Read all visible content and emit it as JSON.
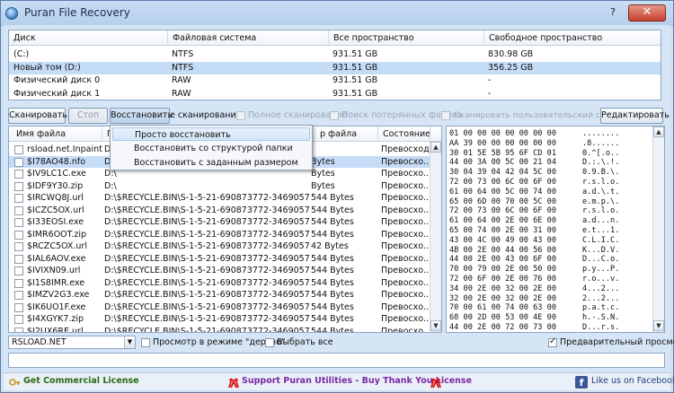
{
  "window": {
    "title": "Puran File Recovery",
    "help": "?",
    "close": "✕"
  },
  "drives": {
    "headers": [
      "Диск",
      "Файловая система",
      "Все пространство",
      "Свободное пространство"
    ],
    "rows": [
      {
        "name": "(C:)",
        "fs": "NTFS",
        "total": "931.51 GB",
        "free": "830.98 GB",
        "selected": false
      },
      {
        "name": "Новый том (D:)",
        "fs": "NTFS",
        "total": "931.51 GB",
        "free": "356.25 GB",
        "selected": true
      },
      {
        "name": "Физический диск 0",
        "fs": "RAW",
        "total": "931.51 GB",
        "free": "-",
        "selected": false
      },
      {
        "name": "Физический диск 1",
        "fs": "RAW",
        "total": "931.51 GB",
        "free": "-",
        "selected": false
      }
    ]
  },
  "toolbar": {
    "scan": "Сканировать",
    "stop": "Стоп",
    "restore": "Восстановить",
    "deep_scan": "е сканирование",
    "full_scan": "Полное сканирование",
    "lost_files": "Поиск потерянных файлов",
    "custom_list": "Сканировать пользовательский список",
    "edit": "Редактировать"
  },
  "files": {
    "headers": {
      "name": "Имя файла",
      "path": "П",
      "size": "р файла",
      "state": "Состояние"
    },
    "rows": [
      {
        "name": "rsload.net.Inpaint...",
        "path": "D:\\",
        "size": "",
        "state": "Превосходно"
      },
      {
        "name": "$I78AO48.nfo",
        "path": "D:\\",
        "size": "Bytes",
        "state": "Превосхо..."
      },
      {
        "name": "$IV9LC1C.exe",
        "path": "D:\\",
        "size": "Bytes",
        "state": "Превосхо..."
      },
      {
        "name": "$IDF9Y30.zip",
        "path": "D:\\",
        "size": "Bytes",
        "state": "Превосхо..."
      },
      {
        "name": "$IRCWQ8J.url",
        "path": "D:\\$RECYCLE.BIN\\S-1-5-21-690873772-346905789...",
        "size": "544 Bytes",
        "state": "Превосхо..."
      },
      {
        "name": "$ICZC5OX.url",
        "path": "D:\\$RECYCLE.BIN\\S-1-5-21-690873772-346905789...",
        "size": "544 Bytes",
        "state": "Превосхо..."
      },
      {
        "name": "$I33EOSI.exe",
        "path": "D:\\$RECYCLE.BIN\\S-1-5-21-690873772-346905789...",
        "size": "544 Bytes",
        "state": "Превосхо..."
      },
      {
        "name": "$IMR6OOT.zip",
        "path": "D:\\$RECYCLE.BIN\\S-1-5-21-690873772-346905789...",
        "size": "544 Bytes",
        "state": "Превосхо..."
      },
      {
        "name": "$RCZC5OX.url",
        "path": "D:\\$RECYCLE.BIN\\S-1-5-21-690873772-346905789...",
        "size": "42 Bytes",
        "state": "Превосхо..."
      },
      {
        "name": "$IAL6AOV.exe",
        "path": "D:\\$RECYCLE.BIN\\S-1-5-21-690873772-346905789...",
        "size": "544 Bytes",
        "state": "Превосхо..."
      },
      {
        "name": "$IVIXN09.url",
        "path": "D:\\$RECYCLE.BIN\\S-1-5-21-690873772-346905789...",
        "size": "544 Bytes",
        "state": "Превосхо..."
      },
      {
        "name": "$I1S8IMR.exe",
        "path": "D:\\$RECYCLE.BIN\\S-1-5-21-690873772-346905789...",
        "size": "544 Bytes",
        "state": "Превосхо..."
      },
      {
        "name": "$IMZV2G3.exe",
        "path": "D:\\$RECYCLE.BIN\\S-1-5-21-690873772-346905789...",
        "size": "544 Bytes",
        "state": "Превосхо..."
      },
      {
        "name": "$IK6UO1F.exe",
        "path": "D:\\$RECYCLE.BIN\\S-1-5-21-690873772-346905789...",
        "size": "544 Bytes",
        "state": "Превосхо..."
      },
      {
        "name": "$I4XGYK7.zip",
        "path": "D:\\$RECYCLE.BIN\\S-1-5-21-690873772-346905789...",
        "size": "544 Bytes",
        "state": "Превосхо..."
      },
      {
        "name": "$I2UX6RE.url",
        "path": "D:\\$RECYCLE.BIN\\S-1-5-21-690873772-346905789...",
        "size": "544 Bytes",
        "state": "Превосхо..."
      }
    ]
  },
  "hex": {
    "rows": [
      {
        "h": "01 00 00 00 00 00 00 00",
        "a": "........"
      },
      {
        "h": "AA 39 00 00 00 00 00 00",
        "a": ".8......"
      },
      {
        "h": "30 01 5E 5B 95 6F CD 01",
        "a": "0.^[.o.."
      },
      {
        "h": "44 00 3A 00 5C 00 21 04",
        "a": "D.:.\\.!."
      },
      {
        "h": "30 04 39 04 42 04 5C 00",
        "a": "0.9.B.\\."
      },
      {
        "h": "72 00 73 00 6C 00 6F 00",
        "a": "r.s.l.o."
      },
      {
        "h": "61 00 64 00 5C 00 74 00",
        "a": "a.d.\\.t."
      },
      {
        "h": "65 00 6D 00 70 00 5C 00",
        "a": "e.m.p.\\."
      },
      {
        "h": "72 00 73 00 6C 00 6F 00",
        "a": "r.s.l.o."
      },
      {
        "h": "61 00 64 00 2E 00 6E 00",
        "a": "a.d...n."
      },
      {
        "h": "65 00 74 00 2E 00 31 00",
        "a": "e.t...1."
      },
      {
        "h": "43 00 4C 00 49 00 43 00",
        "a": "C.L.I.C."
      },
      {
        "h": "4B 00 2E 00 44 00 56 00",
        "a": "K...D.V."
      },
      {
        "h": "44 00 2E 00 43 00 6F 00",
        "a": "D...C.o."
      },
      {
        "h": "70 00 79 00 2E 00 50 00",
        "a": "p.y...P."
      },
      {
        "h": "72 00 6F 00 2E 00 76 00",
        "a": "r.o...v."
      },
      {
        "h": "34 00 2E 00 32 00 2E 00",
        "a": "4...2..."
      },
      {
        "h": "32 00 2E 00 32 00 2E 00",
        "a": "2...2..."
      },
      {
        "h": "70 00 61 00 74 00 63 00",
        "a": "p.a.t.c."
      },
      {
        "h": "68 00 2D 00 53 00 4E 00",
        "a": "h.-.S.N."
      },
      {
        "h": "44 00 2E 00 72 00 73 00",
        "a": "D...r.s."
      }
    ]
  },
  "menu": {
    "items": [
      "Просто восстановить",
      "Восстановить со структурой папки",
      "Восстановить с заданным размером"
    ]
  },
  "bottom": {
    "path": "RSLOAD.NET",
    "tree_view": "Просмотр в режиме \"дерево\"",
    "select_all": "Выбрать все",
    "preview": "Предварительный просмотр"
  },
  "footer": {
    "commercial": "Get Commercial License",
    "support": "Support Puran Utilities - Buy Thank You License",
    "facebook": "Like us on Facebook"
  }
}
